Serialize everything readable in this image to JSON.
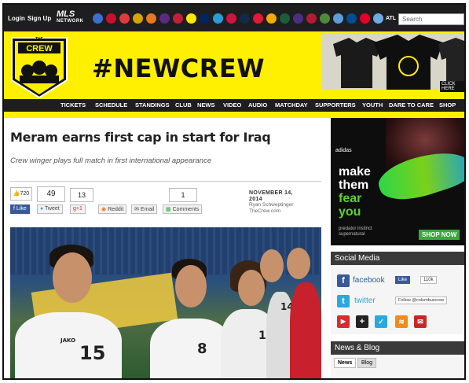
{
  "topbar": {
    "login": "Login",
    "signup": "Sign Up",
    "mls_top": "MLS",
    "mls_bottom": "NETWORK",
    "atl": "ATL",
    "search_placeholder": "Search"
  },
  "header": {
    "crew_text": "CREW",
    "the_text": "THE",
    "headline": "#NEWCREW",
    "click_here": "CLICK HERE"
  },
  "nav": [
    "TICKETS",
    "SCHEDULE",
    "STANDINGS",
    "CLUB",
    "NEWS",
    "VIDEO",
    "AUDIO",
    "MATCHDAY",
    "SUPPORTERS",
    "YOUTH",
    "DARE TO CARE",
    "SHOP"
  ],
  "article": {
    "title": "Meram earns first cap in start for Iraq",
    "subtitle": "Crew winger plays full match in first international appearance",
    "likes": "720",
    "count_49": "49",
    "count_13": "13",
    "count_1": "1",
    "share": {
      "like": "Like",
      "tweet": "Tweet",
      "gplus": "+1",
      "reddit": "Reddit",
      "email": "Email",
      "comments": "Comments"
    },
    "date": "NOVEMBER 14, 2014",
    "author": "Ryan Schweptinger",
    "source": "TheCrew.com",
    "jersey_numbers": [
      "15",
      "8",
      "11",
      "14"
    ],
    "kit_brand": "JAKO"
  },
  "ad": {
    "brand": "adidas",
    "line1": "make",
    "line2": "them",
    "line3": "fear",
    "line4": "you",
    "pred1": "predator instinct",
    "pred2": "supernatural",
    "shop": "SHOP NOW"
  },
  "social": {
    "heading": "Social Media",
    "facebook": "facebook",
    "like": "Like",
    "like_count": "110k",
    "twitter": "twitter",
    "follow": "Follow @columbuscrew"
  },
  "news": {
    "heading": "News & Blog",
    "tab_news": "News",
    "tab_blog": "Blog"
  },
  "colors": {
    "brand_yellow": "#ffef00",
    "dark": "#1e1e1e",
    "facebook": "#3b5998",
    "twitter": "#2aa9e0"
  }
}
